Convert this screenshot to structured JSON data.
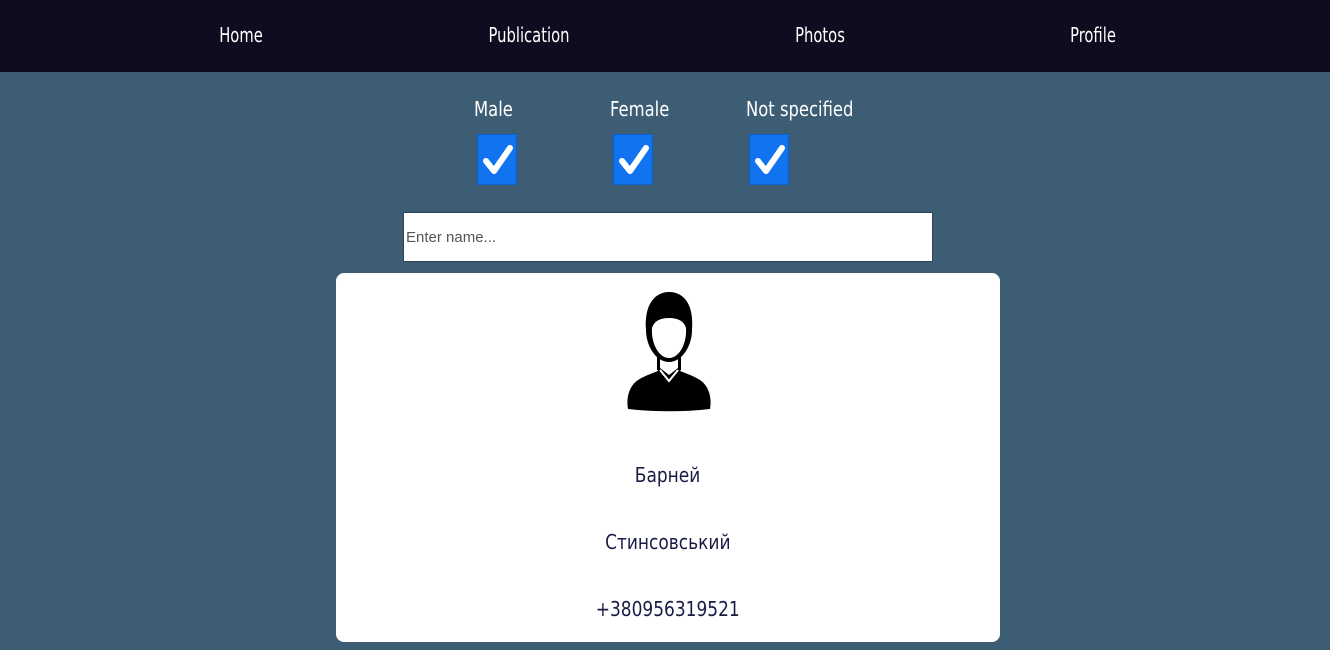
{
  "nav": {
    "home": "Home",
    "publication": "Publication",
    "photos": "Photos",
    "profile": "Profile"
  },
  "filters": {
    "male": {
      "label": "Male",
      "checked": true
    },
    "female": {
      "label": "Female",
      "checked": true
    },
    "not_specified": {
      "label": "Not specified",
      "checked": true
    }
  },
  "search": {
    "placeholder": "Enter name...",
    "value": ""
  },
  "user": {
    "first_name": "Барней",
    "last_name": "Стинсовський",
    "phone": "+380956319521"
  },
  "colors": {
    "navbar": "#0e0c1e",
    "background": "#3d5d75",
    "checkbox": "#1273f0",
    "link": "#1a1b45"
  }
}
